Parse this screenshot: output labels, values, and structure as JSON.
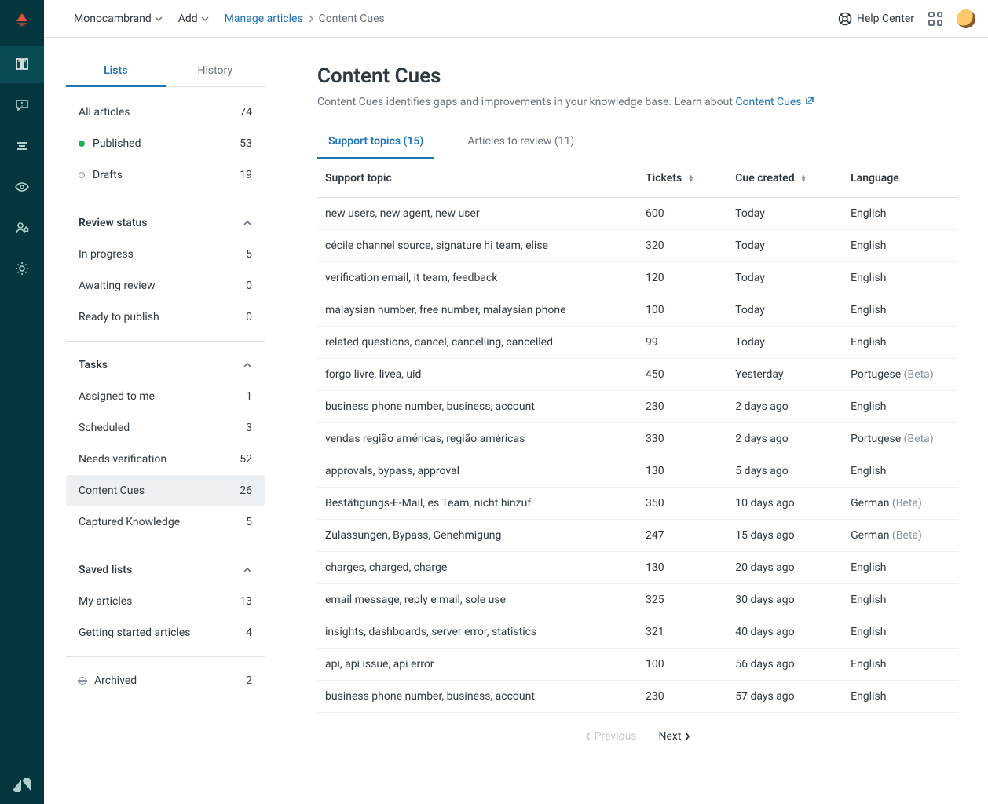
{
  "topbar": {
    "workspace": "Monocambrand",
    "add": "Add",
    "breadcrumb": {
      "parent": "Manage articles",
      "current": "Content Cues"
    },
    "help": "Help Center"
  },
  "sidebar": {
    "tabs": {
      "lists": "Lists",
      "history": "History"
    },
    "all": {
      "label": "All articles",
      "count": "74"
    },
    "published": {
      "label": "Published",
      "count": "53"
    },
    "drafts": {
      "label": "Drafts",
      "count": "19"
    },
    "review_status": {
      "title": "Review status",
      "items": [
        {
          "label": "In progress",
          "count": "5"
        },
        {
          "label": "Awaiting review",
          "count": "0"
        },
        {
          "label": "Ready to publish",
          "count": "0"
        }
      ]
    },
    "tasks": {
      "title": "Tasks",
      "items": [
        {
          "label": "Assigned to me",
          "count": "1"
        },
        {
          "label": "Scheduled",
          "count": "3"
        },
        {
          "label": "Needs verification",
          "count": "52"
        },
        {
          "label": "Content Cues",
          "count": "26"
        },
        {
          "label": "Captured Knowledge",
          "count": "5"
        }
      ]
    },
    "saved": {
      "title": "Saved lists",
      "items": [
        {
          "label": "My articles",
          "count": "13"
        },
        {
          "label": "Getting started articles",
          "count": "4"
        }
      ]
    },
    "archived": {
      "label": "Archived",
      "count": "2"
    }
  },
  "page": {
    "title": "Content Cues",
    "desc_prefix": "Content Cues identifies gaps and improvements in your knowledge base. Learn about ",
    "desc_link": "Content Cues",
    "tabs": {
      "support": "Support topics (15)",
      "review": "Articles to review (11)"
    }
  },
  "table": {
    "headers": {
      "topic": "Support topic",
      "tickets": "Tickets",
      "created": "Cue created",
      "language": "Language"
    },
    "rows": [
      {
        "topic": "new users, new agent, new user",
        "tickets": "600",
        "created": "Today",
        "language": "English",
        "beta": ""
      },
      {
        "topic": "cécile channel source, signature hi team, elise",
        "tickets": "320",
        "created": "Today",
        "language": "English",
        "beta": ""
      },
      {
        "topic": "verification email, it team, feedback",
        "tickets": "120",
        "created": "Today",
        "language": "English",
        "beta": ""
      },
      {
        "topic": "malaysian number, free number, malaysian phone",
        "tickets": "100",
        "created": "Today",
        "language": "English",
        "beta": ""
      },
      {
        "topic": "related questions, cancel, cancelling, cancelled",
        "tickets": "99",
        "created": "Today",
        "language": "English",
        "beta": ""
      },
      {
        "topic": "forgo livre, livea, uid",
        "tickets": "450",
        "created": "Yesterday",
        "language": "Portugese",
        "beta": "(Beta)"
      },
      {
        "topic": "business phone number, business, account",
        "tickets": "230",
        "created": "2 days ago",
        "language": "English",
        "beta": ""
      },
      {
        "topic": "vendas região américas, região américas",
        "tickets": "330",
        "created": "2 days ago",
        "language": "Portugese",
        "beta": "(Beta)"
      },
      {
        "topic": "approvals, bypass, approval",
        "tickets": "130",
        "created": "5 days ago",
        "language": "English",
        "beta": ""
      },
      {
        "topic": "Bestätigungs-E-Mail, es Team, nicht hinzuf",
        "tickets": "350",
        "created": "10 days ago",
        "language": "German",
        "beta": "(Beta)"
      },
      {
        "topic": "Zulassungen, Bypass, Genehmigung",
        "tickets": "247",
        "created": "15 days ago",
        "language": "German",
        "beta": "(Beta)"
      },
      {
        "topic": "charges, charged, charge",
        "tickets": "130",
        "created": "20 days ago",
        "language": "English",
        "beta": ""
      },
      {
        "topic": "email message, reply e mail, sole use",
        "tickets": "325",
        "created": "30 days ago",
        "language": "English",
        "beta": ""
      },
      {
        "topic": "insights, dashboards, server error, statistics",
        "tickets": "321",
        "created": "40 days ago",
        "language": "English",
        "beta": ""
      },
      {
        "topic": "api, api issue, api error",
        "tickets": "100",
        "created": "56 days ago",
        "language": "English",
        "beta": ""
      },
      {
        "topic": "business phone number, business, account",
        "tickets": "230",
        "created": "57 days ago",
        "language": "English",
        "beta": ""
      }
    ]
  },
  "pagination": {
    "prev": "Previous",
    "next": "Next"
  }
}
